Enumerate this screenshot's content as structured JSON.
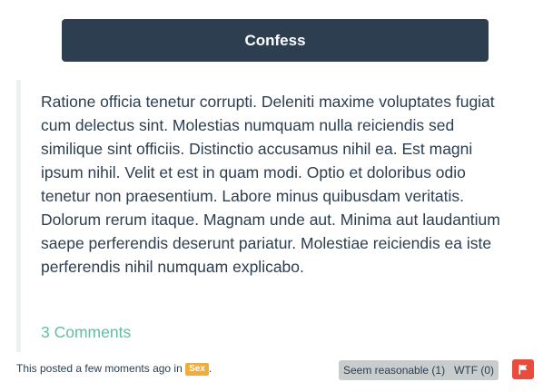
{
  "header": {
    "confess_label": "Confess"
  },
  "confession": {
    "text": "Ratione officia tenetur corrupti. Deleniti maxime voluptates fugiat cum delectus sint. Molestias numquam nulla reiciendis sed similique sint officiis. Distinctio accusamus nihil ea. Est magni ipsum nihil. Velit et est in quam modi. Optio et doloribus odio tenetur non praesentium. Labore minus quibusdam veritatis. Dolorum rerum itaque. Magnam unde aut. Minima aut laudantium saepe perferendis deserunt pariatur. Molestiae reiciendis ea iste perferendis nihil numquam explicabo.",
    "comments_label": "3 Comments"
  },
  "meta": {
    "prefix": "This posted a few moments ago in ",
    "category": "Sex",
    "suffix": "."
  },
  "votes": {
    "reasonable_label": "Seem reasonable (1)",
    "wtf_label": "WTF (0)"
  },
  "report": {
    "icon": "flag-icon"
  },
  "colors": {
    "primary": "#2c3e50",
    "comments_link": "#5fbf9f",
    "category_badge": "#f0ad3f",
    "vote_bg": "#c8cccd",
    "report": "#e74c3c"
  }
}
